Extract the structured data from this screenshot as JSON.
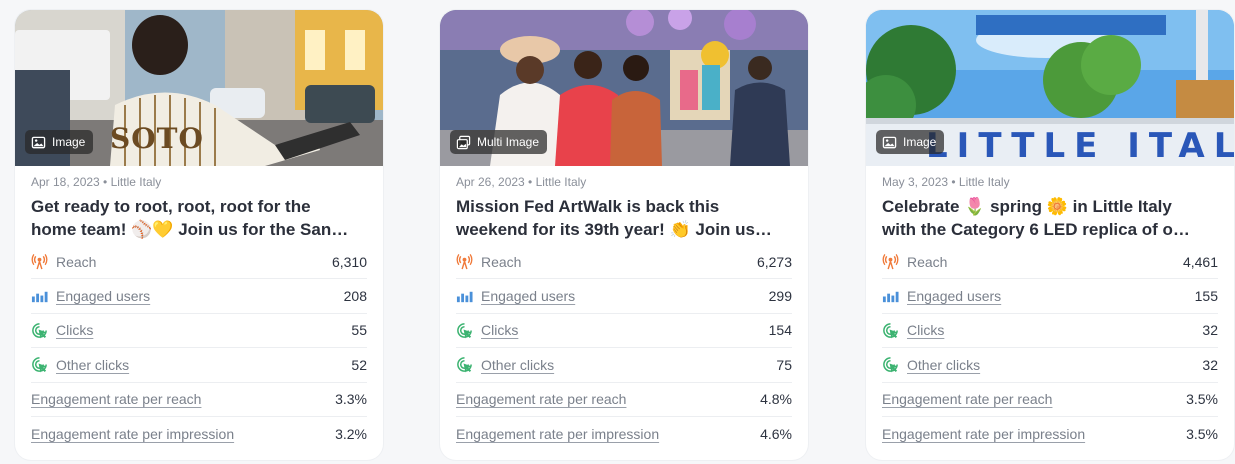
{
  "cards": [
    {
      "badge": "Image",
      "meta": "Apr 18, 2023 • Little Italy",
      "title_line1": "Get ready to root, root, root for the",
      "title_line2": "home team! ⚾💛 Join us for the San…",
      "stats": {
        "reach": {
          "label": "Reach",
          "value": "6,310"
        },
        "engaged": {
          "label": "Engaged users",
          "value": "208"
        },
        "clicks": {
          "label": "Clicks",
          "value": "55"
        },
        "other": {
          "label": "Other clicks",
          "value": "52"
        },
        "err": {
          "label": "Engagement rate per reach",
          "value": "3.3%"
        },
        "eri": {
          "label": "Engagement rate per impression",
          "value": "3.2%"
        }
      },
      "image_text": "SOTO"
    },
    {
      "badge": "Multi Image",
      "meta": "Apr 26, 2023 • Little Italy",
      "title_line1": "Mission Fed ArtWalk is back this",
      "title_line2": "weekend for its 39th year! 👏 Join us…",
      "stats": {
        "reach": {
          "label": "Reach",
          "value": "6,273"
        },
        "engaged": {
          "label": "Engaged users",
          "value": "299"
        },
        "clicks": {
          "label": "Clicks",
          "value": "154"
        },
        "other": {
          "label": "Other clicks",
          "value": "75"
        },
        "err": {
          "label": "Engagement rate per reach",
          "value": "4.8%"
        },
        "eri": {
          "label": "Engagement rate per impression",
          "value": "4.6%"
        }
      }
    },
    {
      "badge": "Image",
      "meta": "May 3, 2023 • Little Italy",
      "title_line1": "Celebrate 🌷 spring 🌼 in Little Italy",
      "title_line2": "with the Category 6 LED replica of o…",
      "stats": {
        "reach": {
          "label": "Reach",
          "value": "4,461"
        },
        "engaged": {
          "label": "Engaged users",
          "value": "155"
        },
        "clicks": {
          "label": "Clicks",
          "value": "32"
        },
        "other": {
          "label": "Other clicks",
          "value": "32"
        },
        "err": {
          "label": "Engagement rate per reach",
          "value": "3.5%"
        },
        "eri": {
          "label": "Engagement rate per impression",
          "value": "3.5%"
        }
      },
      "image_text": "LITTLE ITALY"
    }
  ],
  "colors": {
    "reach_icon": "#f07a3a",
    "engaged_icon": "#4a90d9",
    "clicks_icon": "#3cb371"
  },
  "icons": {
    "reach": "broadcast-icon",
    "engaged": "bar-chart-icon",
    "clicks": "cursor-click-icon",
    "badge_image": "image-icon",
    "badge_multi": "multi-image-icon"
  }
}
